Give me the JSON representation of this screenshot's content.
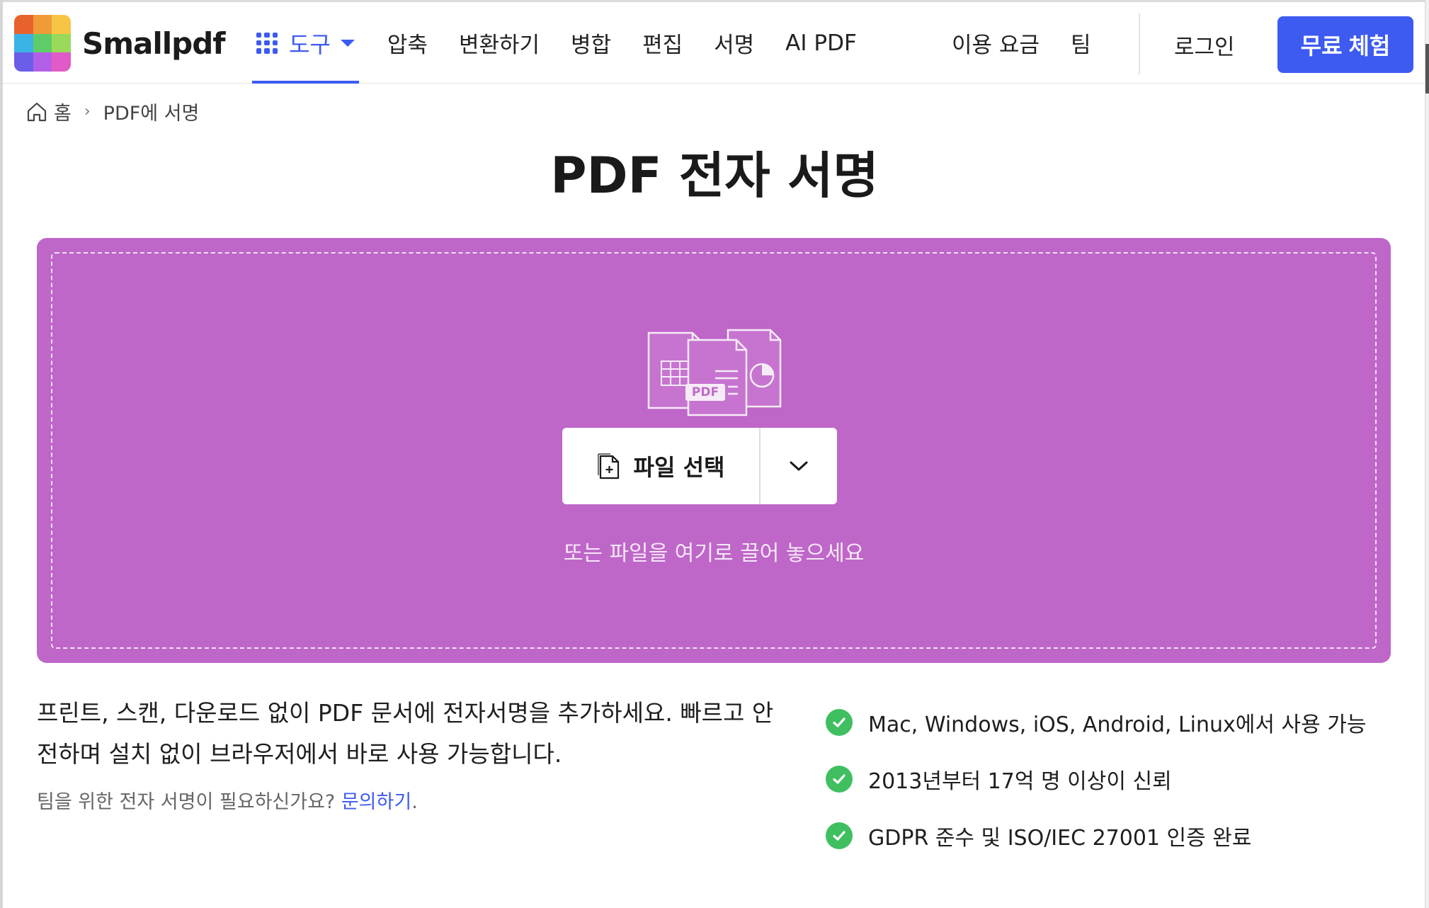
{
  "header": {
    "logo_text": "Smallpdf",
    "nav": {
      "tools_label": "도구",
      "items": [
        "압축",
        "변환하기",
        "병합",
        "편집",
        "서명",
        "AI PDF"
      ],
      "pricing_label": "이용 요금",
      "team_label": "팀"
    },
    "login_label": "로그인",
    "trial_label": "무료 체험"
  },
  "breadcrumb": {
    "home_label": "홈",
    "current_label": "PDF에 서명"
  },
  "main": {
    "title": "PDF 전자 서명",
    "dropzone": {
      "choose_label": "파일 선택",
      "hint": "또는 파일을 여기로 끌어 놓으세요",
      "pdf_badge": "PDF"
    },
    "description": "프린트, 스캔, 다운로드 없이 PDF 문서에 전자서명을 추가하세요. 빠르고 안전하며 설치 없이 브라우저에서 바로 사용 가능합니다.",
    "team_note_prefix": "팀을 위한 전자 서명이 필요하신가요? ",
    "team_note_link": "문의하기",
    "team_note_suffix": ".",
    "features": [
      "Mac, Windows, iOS, Android, Linux에서 사용 가능",
      "2013년부터 17억 명 이상이 신뢰",
      "GDPR 준수 및 ISO/IEC 27001 인증 완료"
    ]
  },
  "colors": {
    "accent": "#3d5af1",
    "dropzone": "#bf66c9",
    "check": "#3fbf5f",
    "logo": [
      "#e8632b",
      "#f19a38",
      "#f7c545",
      "#3bb3e6",
      "#5fcc6a",
      "#9ad95a",
      "#6a5de8",
      "#b25ee6",
      "#e05bc7"
    ]
  },
  "icons": [
    "grid-icon",
    "chevron-down-icon",
    "home-icon",
    "file-add-icon",
    "check-circle-icon"
  ]
}
